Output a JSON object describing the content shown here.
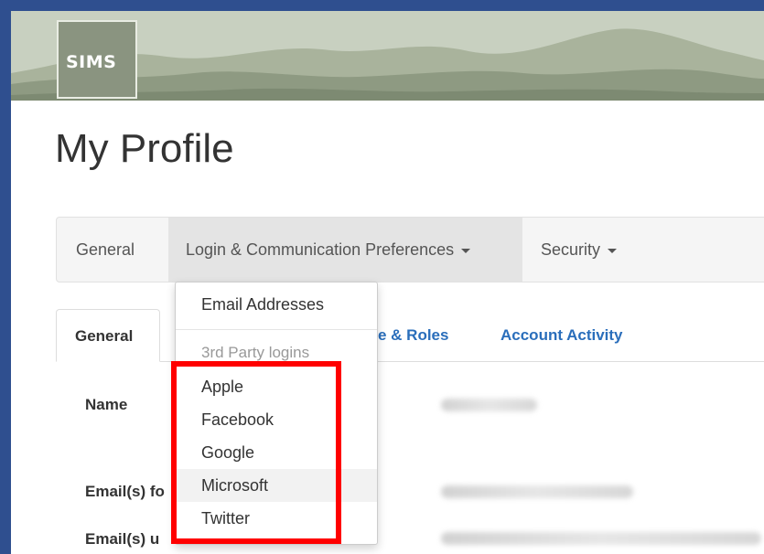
{
  "header": {
    "logo_text": "SIMS"
  },
  "page": {
    "title": "My Profile"
  },
  "nav": {
    "items": [
      {
        "label": "General"
      },
      {
        "label": "Login & Communication Preferences"
      },
      {
        "label": "Security"
      }
    ]
  },
  "tabs": [
    {
      "label": "General"
    },
    {
      "label": "e & Roles"
    },
    {
      "label": "Account Activity"
    }
  ],
  "form": {
    "rows": [
      {
        "label": "Name"
      },
      {
        "label": "Email(s) fo"
      },
      {
        "label": "Email(s) u"
      }
    ]
  },
  "dropdown": {
    "items_top": [
      {
        "label": "Email Addresses"
      }
    ],
    "header": "3rd Party logins",
    "providers": [
      {
        "label": "Apple"
      },
      {
        "label": "Facebook"
      },
      {
        "label": "Google"
      },
      {
        "label": "Microsoft"
      },
      {
        "label": "Twitter"
      }
    ]
  },
  "colors": {
    "frame_border": "#2f4f8f",
    "highlight": "#ff0000",
    "link": "#2a6ebb"
  }
}
